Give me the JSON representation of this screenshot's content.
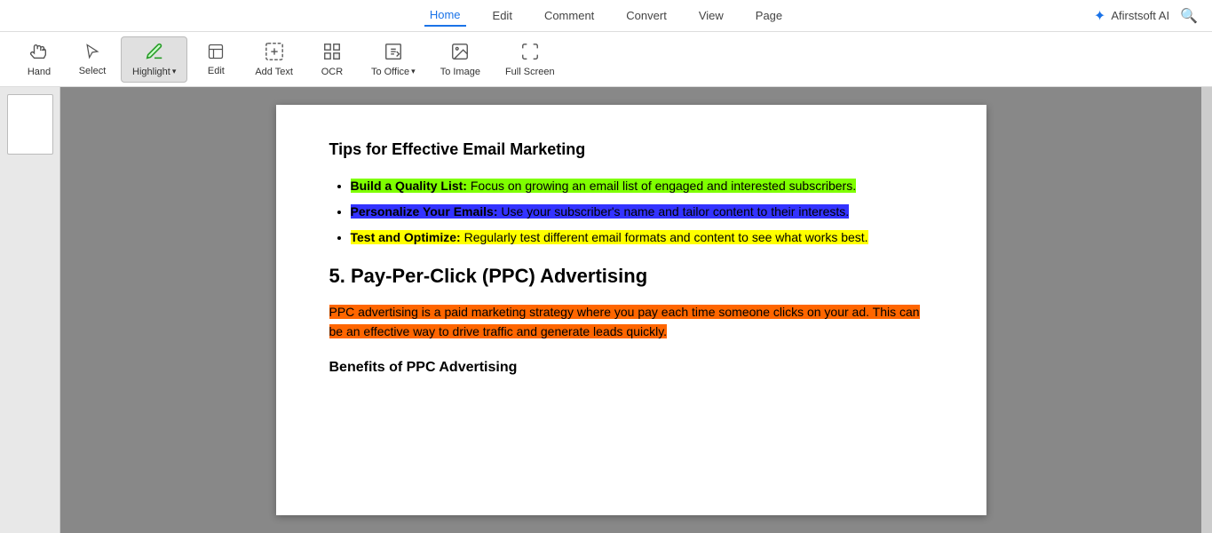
{
  "menuBar": {
    "items": [
      {
        "label": "Home",
        "active": true
      },
      {
        "label": "Edit",
        "active": false
      },
      {
        "label": "Comment",
        "active": false
      },
      {
        "label": "Convert",
        "active": false
      },
      {
        "label": "View",
        "active": false
      },
      {
        "label": "Page",
        "active": false
      }
    ],
    "brand": "Afirstsoft AI",
    "searchIcon": "🔍"
  },
  "toolbar": {
    "tools": [
      {
        "name": "hand",
        "icon": "✋",
        "label": "Hand",
        "active": false,
        "hasDropdown": false
      },
      {
        "name": "select",
        "icon": "↖",
        "label": "Select",
        "active": false,
        "hasDropdown": false
      },
      {
        "name": "highlight",
        "icon": "✏",
        "label": "Highlight",
        "active": true,
        "hasDropdown": true
      },
      {
        "name": "edit",
        "icon": "✏",
        "label": "Edit",
        "active": false,
        "hasDropdown": false
      },
      {
        "name": "add-text",
        "icon": "⊞",
        "label": "Add Text",
        "active": false,
        "hasDropdown": false
      },
      {
        "name": "ocr",
        "icon": "⊡",
        "label": "OCR",
        "active": false,
        "hasDropdown": false
      },
      {
        "name": "to-office",
        "icon": "⊡",
        "label": "To Office",
        "active": false,
        "hasDropdown": true
      },
      {
        "name": "to-image",
        "icon": "⊡",
        "label": "To Image",
        "active": false,
        "hasDropdown": false
      },
      {
        "name": "full-screen",
        "icon": "⛶",
        "label": "Full Screen",
        "active": false,
        "hasDropdown": false
      }
    ]
  },
  "document": {
    "emailMarketingTitle": "Tips for Effective Email Marketing",
    "bullets": [
      {
        "boldText": "Build a Quality List:",
        "normalText": " Focus on growing an email list of engaged and interested subscribers.",
        "highlight": "green"
      },
      {
        "boldText": "Personalize Your Emails:",
        "normalText": " Use your subscriber's name and tailor content to their interests.",
        "highlight": "blue"
      },
      {
        "boldText": "Test and Optimize:",
        "normalText": " Regularly test different email formats and content to see what works best.",
        "highlight": "yellow"
      }
    ],
    "ppcTitle": "5. Pay-Per-Click (PPC) Advertising",
    "ppcBody": "PPC advertising is a paid marketing strategy where you pay each time someone clicks on your ad. This can be an effective way to drive traffic and generate leads quickly.",
    "benefitsTitle": "Benefits of PPC Advertising"
  }
}
